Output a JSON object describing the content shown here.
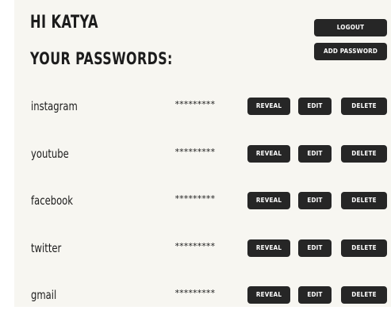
{
  "header": {
    "greeting": "HI KATYA",
    "title": "YOUR PASSWORDS:",
    "logout_label": "LOGOUT",
    "add_label": "ADD PASSWORD"
  },
  "row_actions": {
    "reveal_label": "REVEAL",
    "edit_label": "EDIT",
    "delete_label": "DELETE"
  },
  "passwords": [
    {
      "site": "instagram",
      "masked": "*********"
    },
    {
      "site": "youtube",
      "masked": "*********"
    },
    {
      "site": "facebook",
      "masked": "*********"
    },
    {
      "site": "twitter",
      "masked": "*********"
    },
    {
      "site": "gmail",
      "masked": "*********"
    }
  ],
  "colors": {
    "background": "#f7f6f1",
    "button": "#262626",
    "button_text": "#ffffff",
    "text": "#1c1c1c"
  }
}
